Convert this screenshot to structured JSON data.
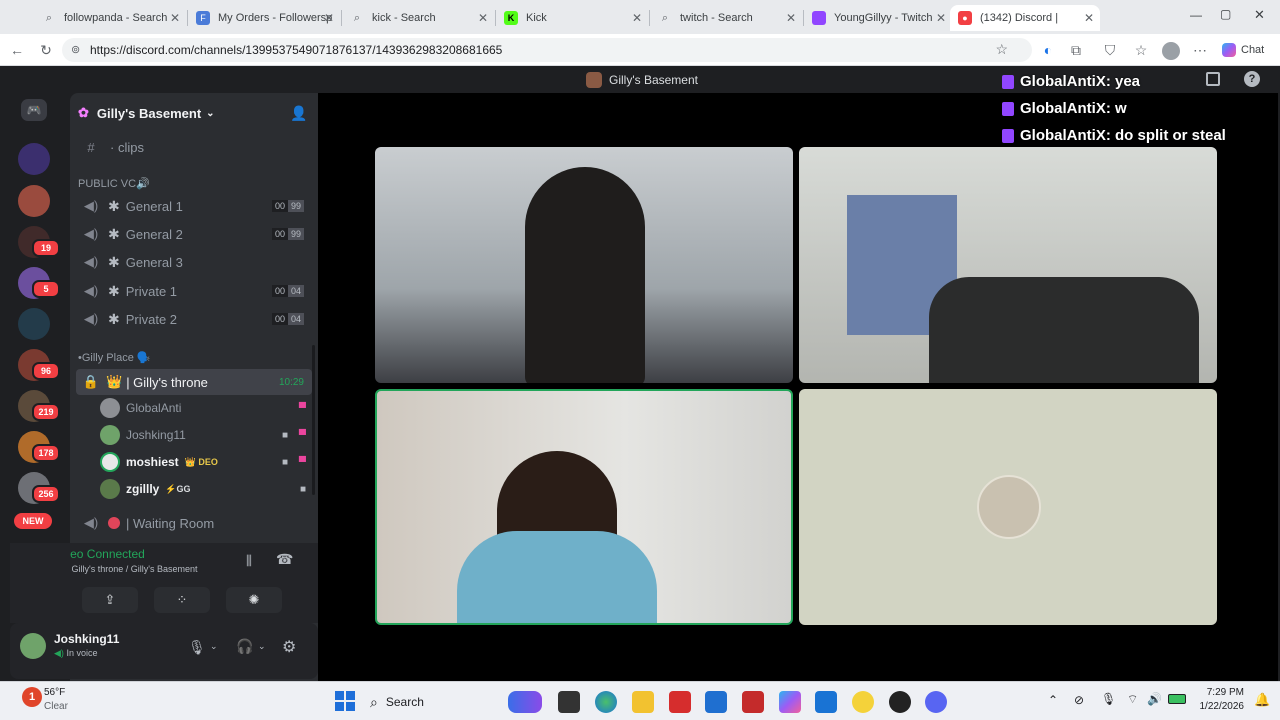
{
  "browser": {
    "tabs": [
      {
        "title": "followpanda - Search",
        "icon": "search-icon"
      },
      {
        "title": "My Orders - Followersp",
        "icon": "page-icon"
      },
      {
        "title": "kick - Search",
        "icon": "search-icon"
      },
      {
        "title": "Kick",
        "icon": "kick-icon"
      },
      {
        "title": "twitch - Search",
        "icon": "search-icon"
      },
      {
        "title": "YoungGillyy - Twitch",
        "icon": "twitch-icon"
      },
      {
        "title": "(1342) Discord |",
        "icon": "discord-icon",
        "active": true
      }
    ],
    "url": "https://discord.com/channels/1399537549071876137/1439362983208681665",
    "chat_label": "Chat"
  },
  "discord": {
    "title": "Gilly's Basement",
    "server_name": "Gilly's Basement",
    "server_badges": [
      "19",
      "5",
      "96",
      "219",
      "178",
      "256"
    ],
    "new_label": "NEW",
    "text_channel": "· clips",
    "category_public": "PUBLIC VC🔊",
    "voice_channels": [
      {
        "name": "General 1",
        "a": "00",
        "b": "99"
      },
      {
        "name": "General 2",
        "a": "00",
        "b": "99"
      },
      {
        "name": "General 3",
        "a": "",
        "b": ""
      },
      {
        "name": "Private 1",
        "a": "00",
        "b": "04"
      },
      {
        "name": "Private 2",
        "a": "00",
        "b": "04"
      }
    ],
    "category_gilly": "•Gilly Place 🗣️",
    "throne": {
      "name": "| Gilly's throne",
      "time": "10:29"
    },
    "members": [
      {
        "name": "GlobalAnti",
        "tag": ""
      },
      {
        "name": "Joshking11",
        "tag": ""
      },
      {
        "name": "moshiest",
        "tag": "👑 DEO"
      },
      {
        "name": "zgillly",
        "tag": "⚡GG"
      }
    ],
    "waiting_room": "| Waiting Room",
    "voice_status": "Video Connected",
    "voice_location": "👑 | Gilly's throne / Gilly's Basement",
    "user": {
      "name": "Joshking11",
      "status": "In voice"
    }
  },
  "chat_overlay": [
    "GlobalAntiX: yea",
    "GlobalAntiX: w",
    "GlobalAntiX: do split or steal"
  ],
  "taskbar": {
    "weather_temp": "56°F",
    "weather_desc": "Clear",
    "search_label": "Search",
    "time": "7:29 PM",
    "date": "1/22/2026"
  }
}
